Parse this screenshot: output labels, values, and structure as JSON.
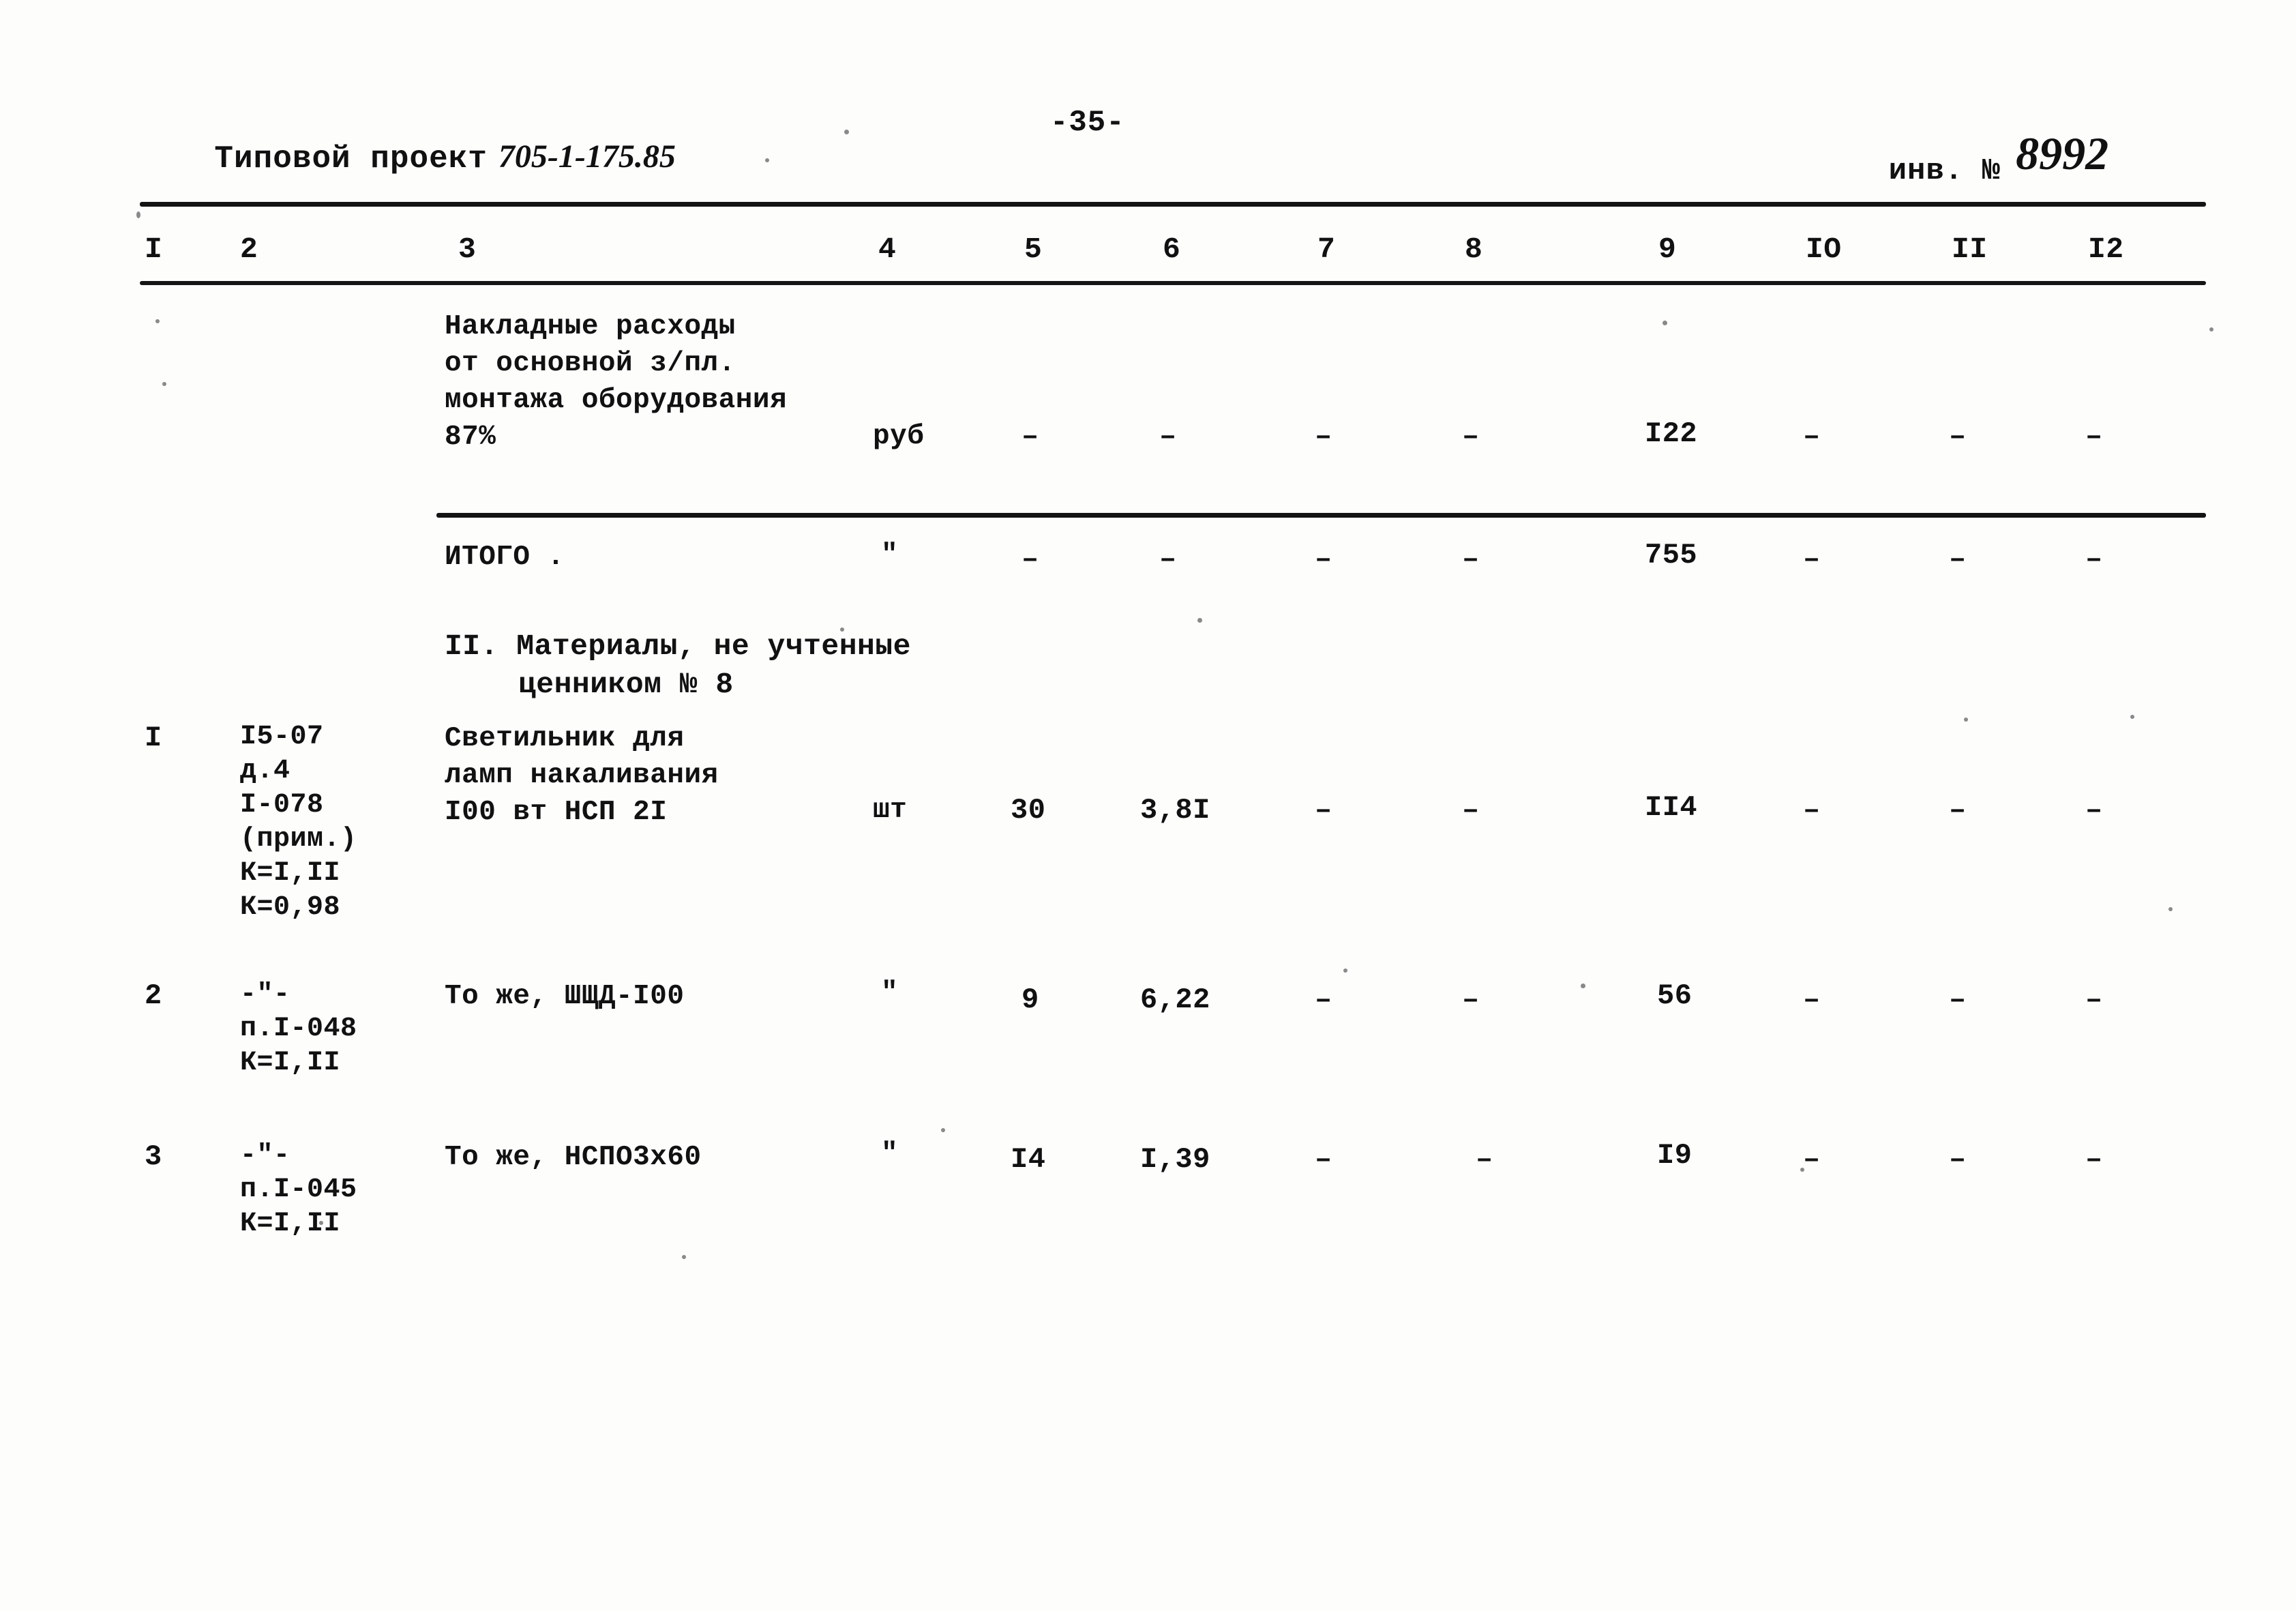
{
  "header": {
    "title_prefix": "Типовой проект",
    "project_number": "705-1-175.85",
    "page_number": "-35-",
    "inv_label": "инв. №",
    "inv_number": "8992"
  },
  "table": {
    "column_headers": [
      "I",
      "2",
      "3",
      "4",
      "5",
      "6",
      "7",
      "8",
      "9",
      "IO",
      "II",
      "I2"
    ],
    "dash": "–",
    "rows": [
      {
        "name": "overhead-row",
        "no": "",
        "code": "",
        "description": "Накладные расходы\nот основной з/пл.\nмонтажа оборудования\n87%",
        "unit": "руб",
        "c5": "–",
        "c6": "–",
        "c7": "–",
        "c8": "–",
        "c9": "I22",
        "c10": "–",
        "c11": "–",
        "c12": "–"
      },
      {
        "name": "total-row",
        "no": "",
        "code": "",
        "description": "ИТОГО .",
        "unit": "\"",
        "c5": "–",
        "c6": "–",
        "c7": "–",
        "c8": "–",
        "c9": "755",
        "c10": "–",
        "c11": "–",
        "c12": "–"
      },
      {
        "name": "item-1",
        "no": "I",
        "code": "I5-07\nд.4\nI-078\n(прим.)\nК=I,II\nК=0,98",
        "description": "Светильник для\nламп накаливания\nI00 вт НСП 2I",
        "unit": "шт",
        "c5": "30",
        "c6": "3,8I",
        "c7": "–",
        "c8": "–",
        "c9": "II4",
        "c10": "–",
        "c11": "–",
        "c12": "–"
      },
      {
        "name": "item-2",
        "no": "2",
        "code": "-\"-\nп.I-048\nК=I,II",
        "description": "То же, ШЩД-I00",
        "unit": "\"",
        "c5": "9",
        "c6": "6,22",
        "c7": "–",
        "c8": "–",
        "c9": "56",
        "c10": "–",
        "c11": "–",
        "c12": "–"
      },
      {
        "name": "item-3",
        "no": "3",
        "code": "-\"-\nп.I-045\nК=I,II",
        "description": "То же, НСПО3х60",
        "unit": "\"",
        "c5": "I4",
        "c6": "I,39",
        "c7": "–",
        "c8": "–",
        "c9": "I9",
        "c10": "–",
        "c11": "–",
        "c12": "–"
      }
    ],
    "section_heading": {
      "line1": "II. Материалы, не учтенные",
      "line2": "ценником № 8"
    }
  }
}
